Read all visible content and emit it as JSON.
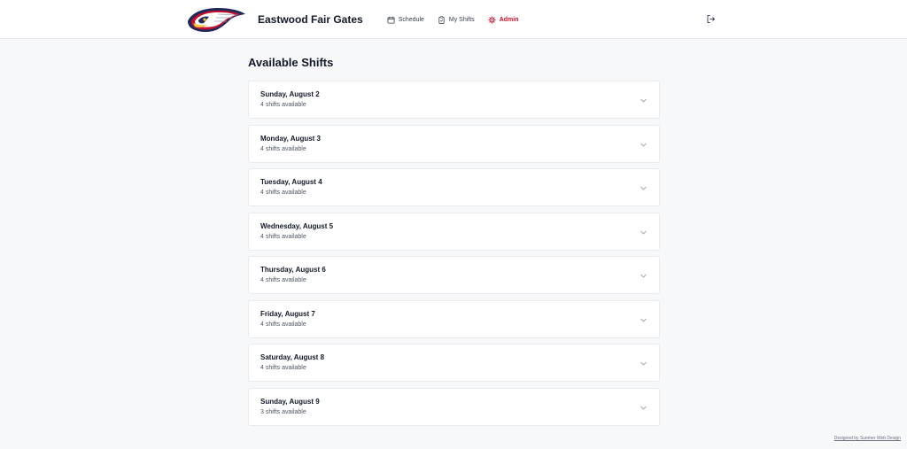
{
  "header": {
    "brand": "Eastwood Fair Gates",
    "logo_icon": "eagle-logo-icon",
    "nav": [
      {
        "label": "Schedule",
        "icon": "calendar-icon",
        "active": false
      },
      {
        "label": "My Shifts",
        "icon": "clipboard-icon",
        "active": false
      },
      {
        "label": "Admin",
        "icon": "gear-icon",
        "active": true
      }
    ],
    "logout_icon": "logout-icon",
    "accent_color": "#c8102e"
  },
  "main": {
    "title": "Available Shifts",
    "days": [
      {
        "name": "Sunday, August 2",
        "count": "4 shifts available"
      },
      {
        "name": "Monday, August 3",
        "count": "4 shifts available"
      },
      {
        "name": "Tuesday, August 4",
        "count": "4 shifts available"
      },
      {
        "name": "Wednesday, August 5",
        "count": "4 shifts available"
      },
      {
        "name": "Thursday, August 6",
        "count": "4 shifts available"
      },
      {
        "name": "Friday, August 7",
        "count": "4 shifts available"
      },
      {
        "name": "Saturday, August 8",
        "count": "4 shifts available"
      },
      {
        "name": "Sunday, August 9",
        "count": "3 shifts available"
      }
    ]
  },
  "footer": {
    "credit": "Designed by Suemer Web Design"
  }
}
